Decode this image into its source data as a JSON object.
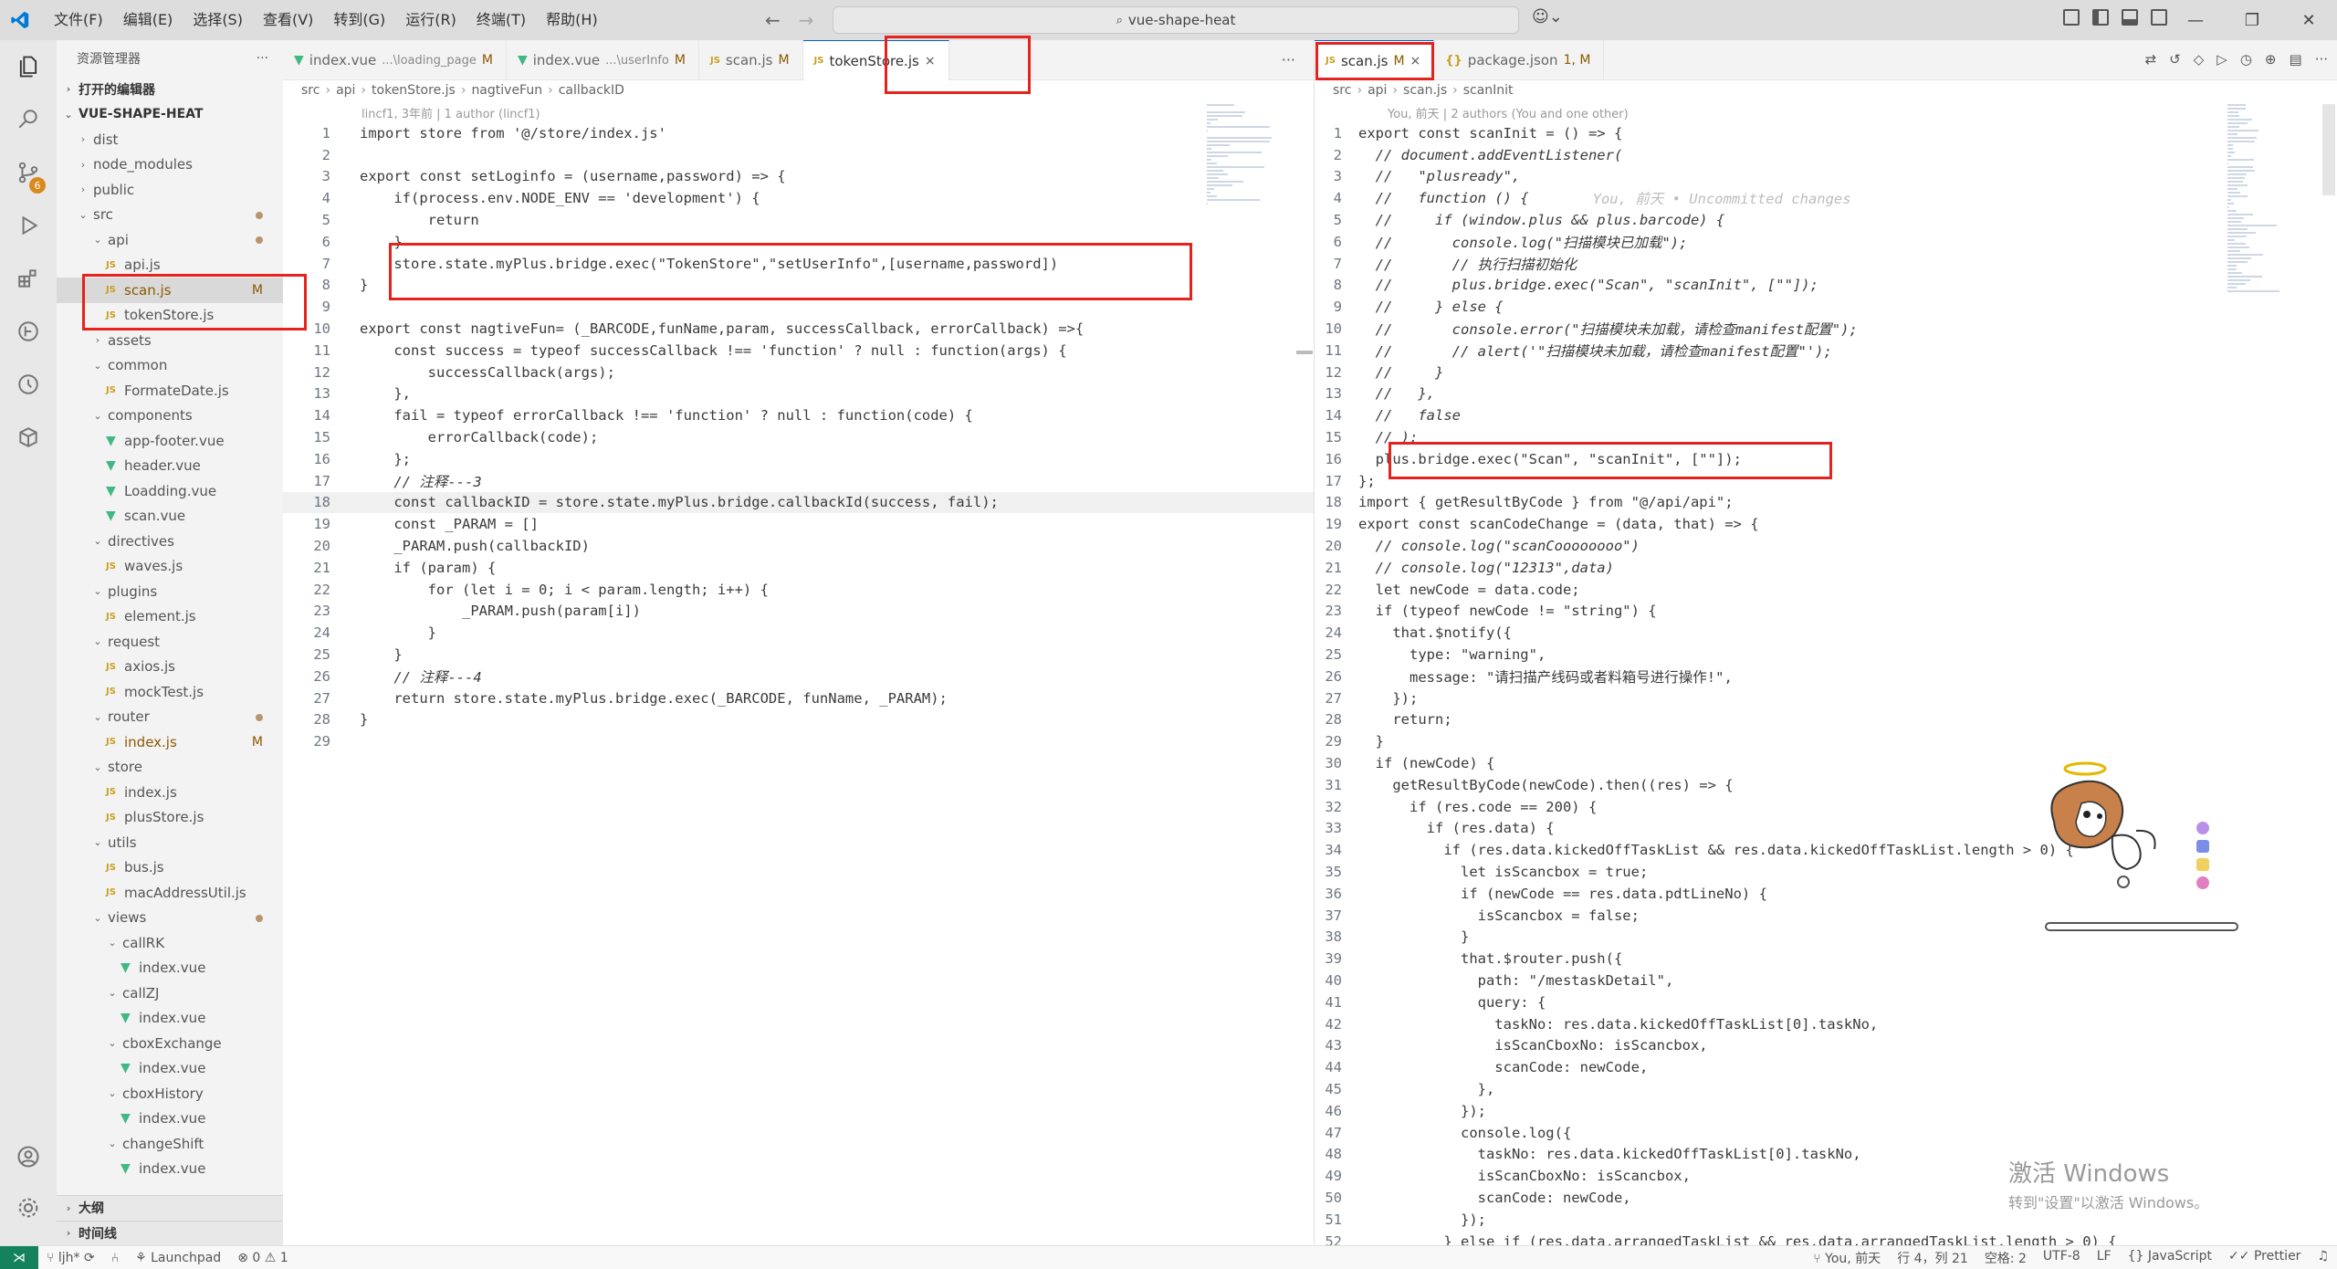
{
  "app": {
    "workspace": "vue-shape-heat",
    "search_icon_text": "🔍"
  },
  "menu": [
    "文件(F)",
    "编辑(E)",
    "选择(S)",
    "查看(V)",
    "转到(G)",
    "运行(R)",
    "终端(T)",
    "帮助(H)"
  ],
  "sidebar": {
    "title": "资源管理器",
    "open_editors": "打开的编辑器",
    "root": "VUE-SHAPE-HEAT",
    "outline": "大纲",
    "timeline": "时间线",
    "tree": [
      {
        "name": "dist",
        "type": "folder",
        "depth": 1,
        "open": false
      },
      {
        "name": "node_modules",
        "type": "folder",
        "depth": 1,
        "open": false
      },
      {
        "name": "public",
        "type": "folder",
        "depth": 1,
        "open": false
      },
      {
        "name": "src",
        "type": "folder",
        "depth": 1,
        "open": true,
        "dot": true
      },
      {
        "name": "api",
        "type": "folder",
        "depth": 2,
        "open": true,
        "dot": true
      },
      {
        "name": "api.js",
        "type": "js",
        "depth": 3
      },
      {
        "name": "scan.js",
        "type": "js",
        "depth": 3,
        "badge": "M",
        "selected": true
      },
      {
        "name": "tokenStore.js",
        "type": "js",
        "depth": 3
      },
      {
        "name": "assets",
        "type": "folder",
        "depth": 2,
        "open": false
      },
      {
        "name": "common",
        "type": "folder",
        "depth": 2,
        "open": true
      },
      {
        "name": "FormateDate.js",
        "type": "js",
        "depth": 3
      },
      {
        "name": "components",
        "type": "folder",
        "depth": 2,
        "open": true
      },
      {
        "name": "app-footer.vue",
        "type": "vue",
        "depth": 3
      },
      {
        "name": "header.vue",
        "type": "vue",
        "depth": 3
      },
      {
        "name": "Loadding.vue",
        "type": "vue",
        "depth": 3
      },
      {
        "name": "scan.vue",
        "type": "vue",
        "depth": 3
      },
      {
        "name": "directives",
        "type": "folder",
        "depth": 2,
        "open": true
      },
      {
        "name": "waves.js",
        "type": "js",
        "depth": 3
      },
      {
        "name": "plugins",
        "type": "folder",
        "depth": 2,
        "open": true
      },
      {
        "name": "element.js",
        "type": "js",
        "depth": 3
      },
      {
        "name": "request",
        "type": "folder",
        "depth": 2,
        "open": true
      },
      {
        "name": "axios.js",
        "type": "js",
        "depth": 3
      },
      {
        "name": "mockTest.js",
        "type": "js",
        "depth": 3
      },
      {
        "name": "router",
        "type": "folder",
        "depth": 2,
        "open": true,
        "dot": true
      },
      {
        "name": "index.js",
        "type": "js",
        "depth": 3,
        "badge": "M"
      },
      {
        "name": "store",
        "type": "folder",
        "depth": 2,
        "open": true
      },
      {
        "name": "index.js",
        "type": "js",
        "depth": 3
      },
      {
        "name": "plusStore.js",
        "type": "js",
        "depth": 3
      },
      {
        "name": "utils",
        "type": "folder",
        "depth": 2,
        "open": true
      },
      {
        "name": "bus.js",
        "type": "js",
        "depth": 3
      },
      {
        "name": "macAddressUtil.js",
        "type": "js",
        "depth": 3
      },
      {
        "name": "views",
        "type": "folder",
        "depth": 2,
        "open": true,
        "dot": true
      },
      {
        "name": "callRK",
        "type": "folder",
        "depth": 3,
        "open": true
      },
      {
        "name": "index.vue",
        "type": "vue",
        "depth": 4
      },
      {
        "name": "callZJ",
        "type": "folder",
        "depth": 3,
        "open": true
      },
      {
        "name": "index.vue",
        "type": "vue",
        "depth": 4
      },
      {
        "name": "cboxExchange",
        "type": "folder",
        "depth": 3,
        "open": true
      },
      {
        "name": "index.vue",
        "type": "vue",
        "depth": 4
      },
      {
        "name": "cboxHistory",
        "type": "folder",
        "depth": 3,
        "open": true
      },
      {
        "name": "index.vue",
        "type": "vue",
        "depth": 4
      },
      {
        "name": "changeShift",
        "type": "folder",
        "depth": 3,
        "open": true
      },
      {
        "name": "index.vue",
        "type": "vue",
        "depth": 4
      }
    ]
  },
  "left_editor": {
    "tabs": [
      {
        "icon": "vue",
        "name": "index.vue",
        "desc": "...\\loading_page",
        "status": "M"
      },
      {
        "icon": "vue",
        "name": "index.vue",
        "desc": "...\\userInfo",
        "status": "M"
      },
      {
        "icon": "JS",
        "name": "scan.js",
        "desc": "",
        "status": "M"
      },
      {
        "icon": "JS",
        "name": "tokenStore.js",
        "desc": "",
        "status": "",
        "active": true,
        "close": "×"
      }
    ],
    "breadcrumb": [
      "src",
      "api",
      "tokenStore.js",
      "nagtiveFun",
      "callbackID"
    ],
    "blame": "lincf1, 3年前 | 1 author (lincf1)",
    "lines": [
      "import store from '@/store/index.js'",
      "",
      "export const setLoginfo = (username,password) => {",
      "    if(process.env.NODE_ENV == 'development') {",
      "        return",
      "    }",
      "    store.state.myPlus.bridge.exec(\"TokenStore\",\"setUserInfo\",[username,password])",
      "}",
      "",
      "export const nagtiveFun= (_BARCODE,funName,param, successCallback, errorCallback) =>{",
      "    const success = typeof successCallback !== 'function' ? null : function(args) {",
      "        successCallback(args);",
      "    },",
      "    fail = typeof errorCallback !== 'function' ? null : function(code) {",
      "        errorCallback(code);",
      "    };",
      "    // 注释---3",
      "    const callbackID = store.state.myPlus.bridge.callbackId(success, fail);",
      "    const _PARAM = []",
      "    _PARAM.push(callbackID)",
      "    if (param) {",
      "        for (let i = 0; i < param.length; i++) {",
      "            _PARAM.push(param[i])",
      "        }",
      "    }",
      "    // 注释---4",
      "    return store.state.myPlus.bridge.exec(_BARCODE, funName, _PARAM);",
      "}",
      ""
    ]
  },
  "right_editor": {
    "tabs": [
      {
        "icon": "JS",
        "name": "scan.js",
        "desc": "",
        "status": "M",
        "active": true,
        "close": "×"
      },
      {
        "icon": "{}",
        "name": "package.json",
        "desc": "",
        "status": "1, M"
      }
    ],
    "breadcrumb": [
      "src",
      "api",
      "scan.js",
      "scanInit"
    ],
    "blame": "You, 前天 | 2 authors (You and one other)",
    "inline_blame": "You, 前天 • Uncommitted changes",
    "lines": [
      "export const scanInit = () => {",
      "  // document.addEventListener(",
      "  //   \"plusready\",",
      "  //   function () {",
      "  //     if (window.plus && plus.barcode) {",
      "  //       console.log(\"扫描模块已加载\");",
      "  //       // 执行扫描初始化",
      "  //       plus.bridge.exec(\"Scan\", \"scanInit\", [\"\"]);",
      "  //     } else {",
      "  //       console.error(\"扫描模块未加载，请检查manifest配置\");",
      "  //       // alert('\"扫描模块未加载，请检查manifest配置\"');",
      "  //     }",
      "  //   },",
      "  //   false",
      "  // );",
      "  plus.bridge.exec(\"Scan\", \"scanInit\", [\"\"]);",
      "};",
      "import { getResultByCode } from \"@/api/api\";",
      "export const scanCodeChange = (data, that) => {",
      "  // console.log(\"scanCoooooooo\")",
      "  // console.log(\"12313\",data)",
      "  let newCode = data.code;",
      "  if (typeof newCode != \"string\") {",
      "    that.$notify({",
      "      type: \"warning\",",
      "      message: \"请扫描产线码或者料箱号进行操作!\",",
      "    });",
      "    return;",
      "  }",
      "  if (newCode) {",
      "    getResultByCode(newCode).then((res) => {",
      "      if (res.code == 200) {",
      "        if (res.data) {",
      "          if (res.data.kickedOffTaskList && res.data.kickedOffTaskList.length > 0) {",
      "            let isScancbox = true;",
      "            if (newCode == res.data.pdtLineNo) {",
      "              isScancbox = false;",
      "            }",
      "            that.$router.push({",
      "              path: \"/mestaskDetail\",",
      "              query: {",
      "                taskNo: res.data.kickedOffTaskList[0].taskNo,",
      "                isScanCboxNo: isScancbox,",
      "                scanCode: newCode,",
      "              },",
      "            });",
      "            console.log({",
      "              taskNo: res.data.kickedOffTaskList[0].taskNo,",
      "              isScanCboxNo: isScancbox,",
      "              scanCode: newCode,",
      "            });",
      "          } else if (res.data.arrangedTaskList && res.data.arrangedTaskList.length > 0) {"
    ]
  },
  "watermark": {
    "line1": "激活 Windows",
    "line2": "转到\"设置\"以激活 Windows。"
  },
  "statusbar": {
    "branch": "ljh*",
    "launchpad": "Launchpad",
    "problems": "⊗ 0 ⚠ 1",
    "blame": "You, 前天",
    "position": "行 4，列 21",
    "spaces": "空格: 2",
    "encoding": "UTF-8",
    "eol": "LF",
    "language": "JavaScript",
    "formatter": "Prettier"
  },
  "activity_badge": "6"
}
